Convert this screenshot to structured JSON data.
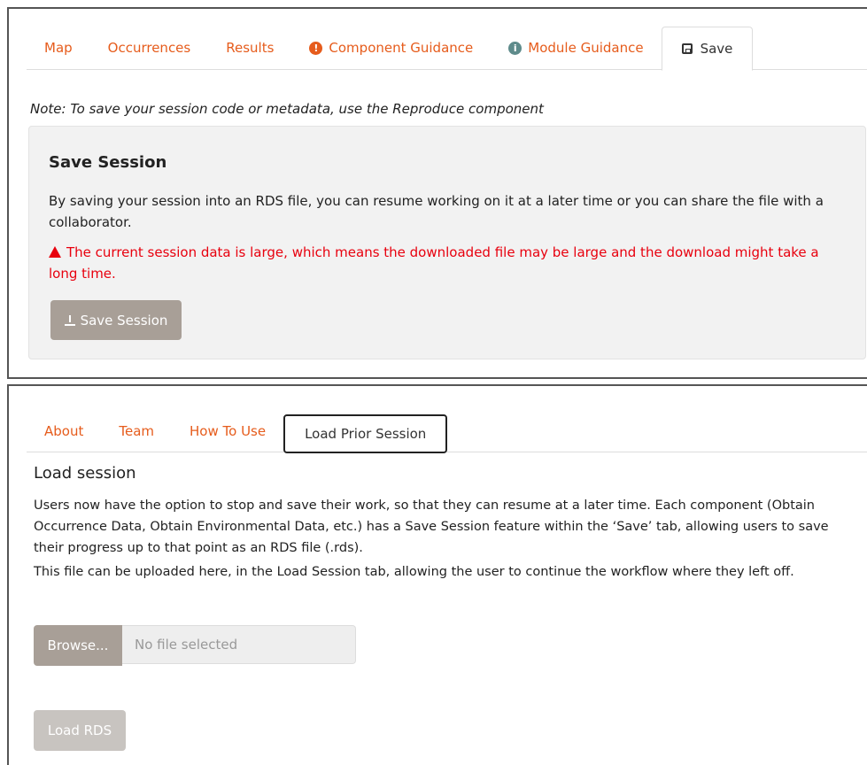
{
  "top_panel": {
    "tabs": [
      {
        "label": "Map"
      },
      {
        "label": "Occurrences"
      },
      {
        "label": "Results"
      },
      {
        "label": "Component Guidance",
        "icon": "exclamation-icon"
      },
      {
        "label": "Module Guidance",
        "icon": "info-icon"
      },
      {
        "label": "Save",
        "icon": "save-icon",
        "active": true
      }
    ],
    "note": "Note: To save your session code or metadata, use the Reproduce component",
    "section_title": "Save Session",
    "description": "By saving your session into an RDS file, you can resume working on it at a later time or you can share the file with a collaborator.",
    "warning": "The current session data is large, which means the downloaded file may be large and the download might take a long time.",
    "save_button": "Save Session"
  },
  "bottom_panel": {
    "tabs": [
      {
        "label": "About"
      },
      {
        "label": "Team"
      },
      {
        "label": "How To Use"
      },
      {
        "label": "Load Prior Session",
        "active": true
      }
    ],
    "heading": "Load session",
    "paragraph1": "Users now have the option to stop and save their work, so that they can resume at a later time. Each component (Obtain Occurrence Data, Obtain Environmental Data, etc.) has a Save Session feature within the ‘Save’ tab, allowing users to save their progress up to that point as an RDS file (.rds).",
    "paragraph2": "This file can be uploaded here, in the Load Session tab, allowing the user to continue the workflow where they left off.",
    "browse_button": "Browse...",
    "file_placeholder": "No file selected",
    "load_button": "Load RDS"
  },
  "colors": {
    "accent": "#e65c1c",
    "warning": "#e8000e",
    "button": "#a89f97",
    "disabled_button": "#c8c4c0"
  }
}
